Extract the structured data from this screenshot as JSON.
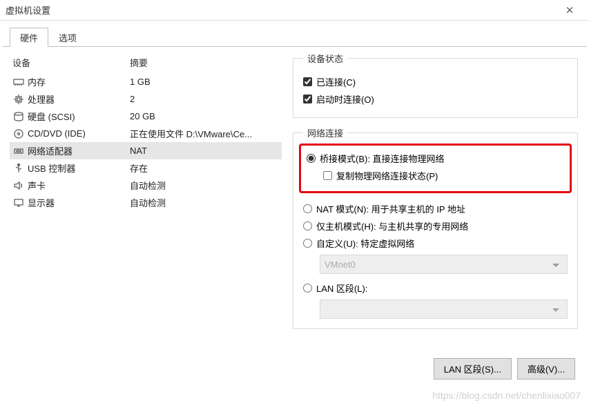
{
  "titlebar": {
    "title": "虚拟机设置"
  },
  "tabs": {
    "hardware": "硬件",
    "options": "选项"
  },
  "device_header": {
    "device": "设备",
    "summary": "摘要"
  },
  "devices": [
    {
      "icon": "memory-icon",
      "name": "内存",
      "summary": "1 GB"
    },
    {
      "icon": "cpu-icon",
      "name": "处理器",
      "summary": "2"
    },
    {
      "icon": "disk-icon",
      "name": "硬盘 (SCSI)",
      "summary": "20 GB"
    },
    {
      "icon": "cd-icon",
      "name": "CD/DVD (IDE)",
      "summary": "正在使用文件 D:\\VMware\\Ce..."
    },
    {
      "icon": "network-icon",
      "name": "网络适配器",
      "summary": "NAT"
    },
    {
      "icon": "usb-icon",
      "name": "USB 控制器",
      "summary": "存在"
    },
    {
      "icon": "sound-icon",
      "name": "声卡",
      "summary": "自动检测"
    },
    {
      "icon": "display-icon",
      "name": "显示器",
      "summary": "自动检测"
    }
  ],
  "device_status": {
    "legend": "设备状态",
    "connected": "已连接(C)",
    "connect_on_power": "启动时连接(O)"
  },
  "network": {
    "legend": "网络连接",
    "bridged": "桥接模式(B): 直接连接物理网络",
    "replicate": "复制物理网络连接状态(P)",
    "nat": "NAT 模式(N): 用于共享主机的 IP 地址",
    "hostonly": "仅主机模式(H): 与主机共享的专用网络",
    "custom": "自定义(U): 特定虚拟网络",
    "custom_value": "VMnet0",
    "lan_segment": "LAN 区段(L):",
    "lan_value": ""
  },
  "buttons": {
    "lan_segments": "LAN 区段(S)...",
    "advanced": "高级(V)..."
  },
  "watermark": "https://blog.csdn.net/chenlixiao007"
}
